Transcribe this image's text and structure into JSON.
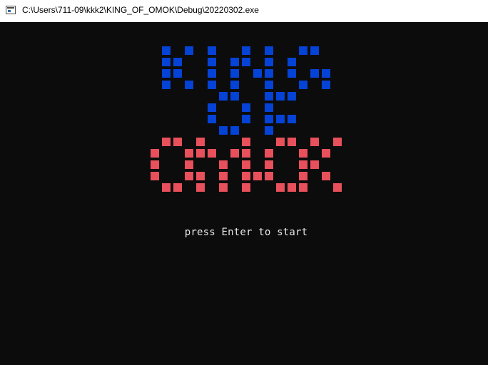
{
  "window": {
    "title": "C:\\Users\\711-09\\kkk2\\KING_OF_OMOK\\Debug\\20220302.exe",
    "icon": "console-app-icon"
  },
  "console": {
    "background": "#0c0c0c",
    "logo": {
      "colors": {
        "king": "#0542d6",
        "of": "#0542d6",
        "omok": "#e8505b"
      }
    },
    "prompt": "press Enter to start"
  }
}
